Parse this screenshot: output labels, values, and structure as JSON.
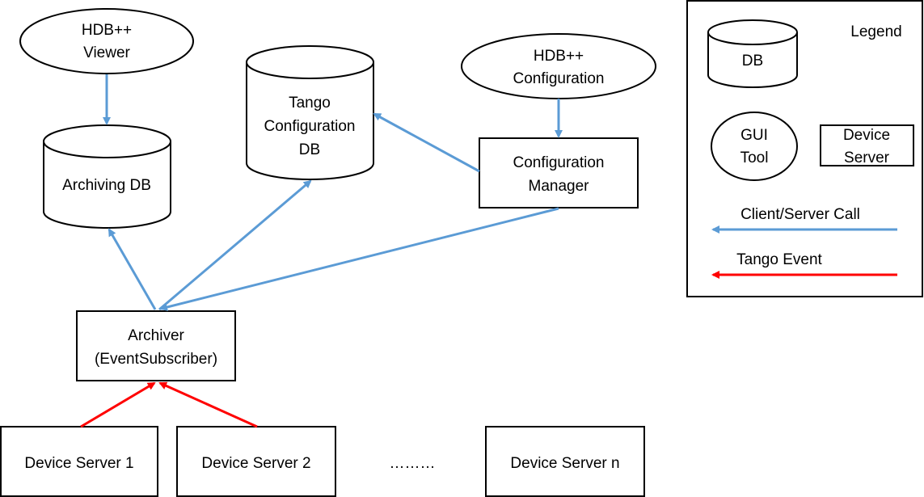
{
  "nodes": {
    "hdb_viewer": [
      "HDB++",
      "Viewer"
    ],
    "archiving_db": [
      "Archiving DB"
    ],
    "tango_db": [
      "Tango",
      "Configuration",
      "DB"
    ],
    "hdb_config": [
      "HDB++",
      "Configuration"
    ],
    "config_manager": [
      "Configuration",
      "Manager"
    ],
    "archiver": [
      "Archiver",
      "(EventSubscriber)"
    ],
    "device_server_1": "Device Server 1",
    "device_server_2": "Device Server 2",
    "ellipsis": "………",
    "device_server_n": "Device Server n"
  },
  "legend": {
    "title": "Legend",
    "db": "DB",
    "gui_tool": [
      "GUI",
      "Tool"
    ],
    "device_server": [
      "Device",
      "Server"
    ],
    "client_server_call": "Client/Server Call",
    "tango_event": "Tango Event"
  },
  "colors": {
    "client_server_call": "#5b9bd5",
    "tango_event": "#ff0000"
  }
}
